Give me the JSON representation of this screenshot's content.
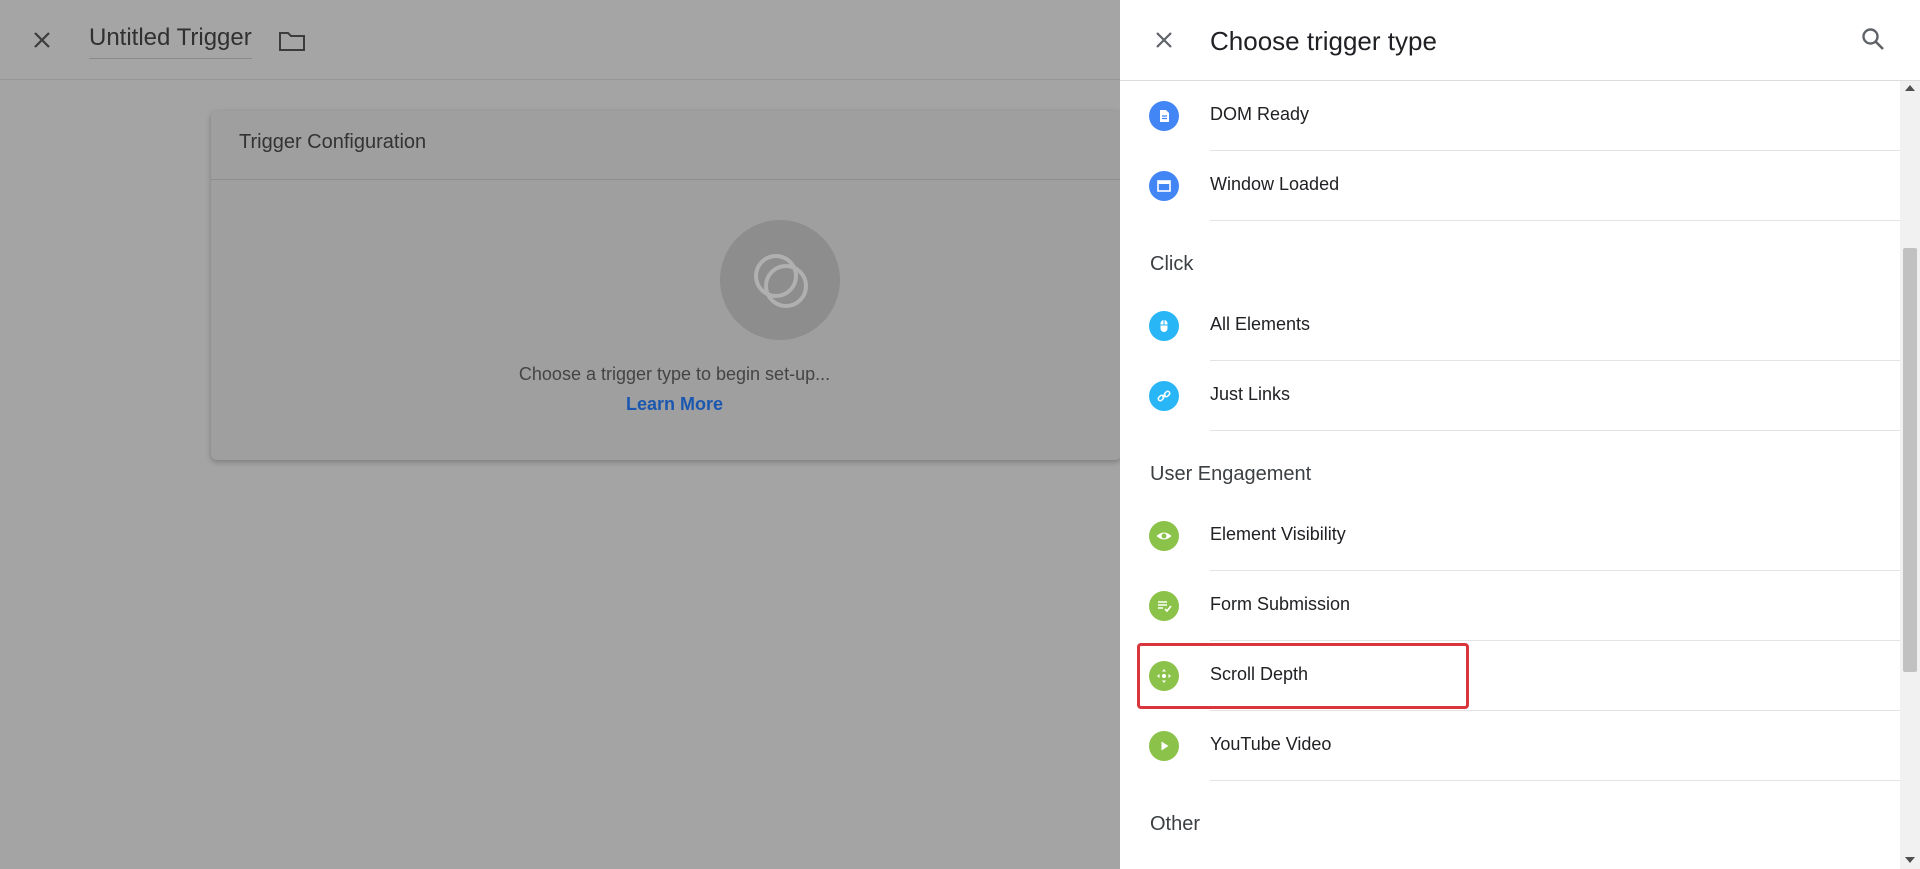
{
  "background": {
    "title": "Untitled Trigger",
    "card": {
      "title": "Trigger Configuration",
      "empty_text": "Choose a trigger type to begin set-up...",
      "learn_more": "Learn More"
    }
  },
  "panel": {
    "title": "Choose trigger type",
    "sections": {
      "click": "Click",
      "user_engagement": "User Engagement",
      "other": "Other"
    },
    "items": [
      {
        "label": "DOM Ready",
        "icon": "document-icon",
        "color": "#4285f4"
      },
      {
        "label": "Window Loaded",
        "icon": "window-icon",
        "color": "#4285f4"
      },
      {
        "label": "All Elements",
        "icon": "mouse-icon",
        "color": "#29b6f6"
      },
      {
        "label": "Just Links",
        "icon": "link-icon",
        "color": "#29b6f6"
      },
      {
        "label": "Element Visibility",
        "icon": "eye-icon",
        "color": "#8bc34a"
      },
      {
        "label": "Form Submission",
        "icon": "form-check-icon",
        "color": "#8bc34a"
      },
      {
        "label": "Scroll Depth",
        "icon": "move-arrows-icon",
        "color": "#8bc34a"
      },
      {
        "label": "YouTube Video",
        "icon": "play-icon",
        "color": "#8bc34a"
      }
    ],
    "highlighted_item": "Scroll Depth",
    "highlight_color": "#d9353f"
  }
}
